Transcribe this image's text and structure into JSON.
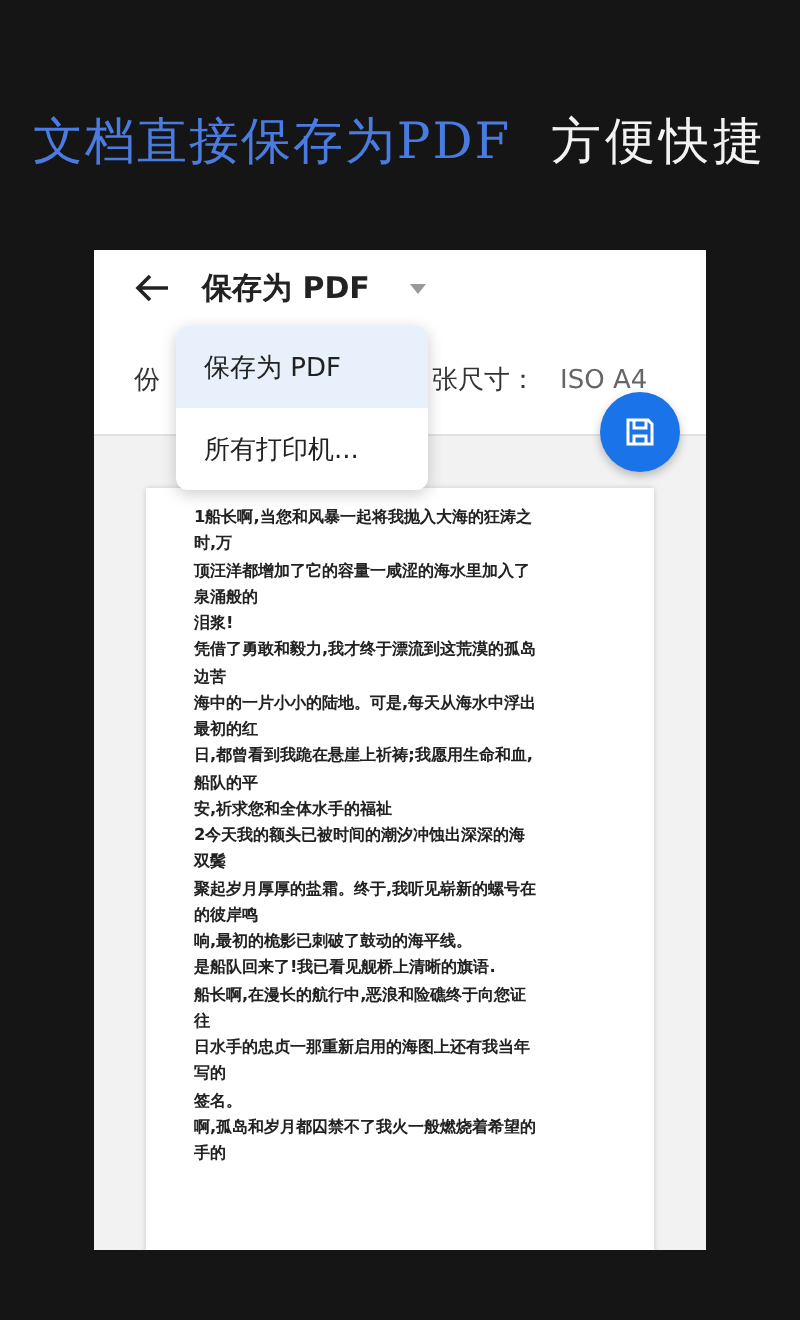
{
  "headline": {
    "highlight": "文档直接保存为PDF",
    "rest": "方便快捷"
  },
  "toolbar": {
    "title": "保存为 PDF"
  },
  "options": {
    "copies_label": "份",
    "paper_size_label": "张尺寸：",
    "paper_size_value": "ISO A4"
  },
  "printer_menu": [
    {
      "label": "保存为 PDF",
      "selected": true
    },
    {
      "label": "所有打印机...",
      "selected": false
    }
  ],
  "preview": {
    "lines": [
      "1船长啊,当您和风暴一起将我抛入大海的狂涛之",
      "时,万",
      "顶汪洋都增加了它的容量一咸涩的海水里加入了",
      "泉涌般的",
      "泪浆!",
      "凭借了勇敢和毅力,我才终于漂流到这荒漠的孤岛",
      "边苦",
      "海中的一片小小的陆地。可是,每天从海水中浮出",
      "最初的红",
      "日,都曾看到我跪在悬崖上祈祷;我愿用生命和血,",
      "船队的平",
      "安,祈求您和全体水手的福祉",
      "2今天我的额头已被时间的潮汐冲蚀出深深的海",
      "双鬓",
      "聚起岁月厚厚的盐霜。终于,我听见崭新的螺号在",
      "的彼岸鸣",
      "响,最初的桅影已刺破了鼓动的海平线。",
      "是船队回来了!我已看见舰桥上清晰的旗语.",
      "船长啊,在漫长的航行中,恶浪和险礁终于向您证",
      "往",
      "日水手的忠贞一那重新启用的海图上还有我当年",
      "写的",
      "签名。",
      "啊,孤岛和岁月都囚禁不了我火一般燃烧着希望的",
      "手的"
    ]
  }
}
